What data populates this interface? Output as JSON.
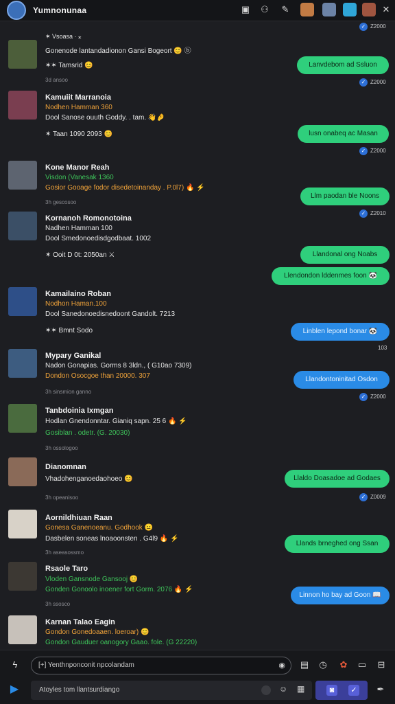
{
  "header": {
    "title": "Yumnonunaa",
    "icons": [
      "screenshot-icon",
      "share-icon",
      "edit-icon",
      "people-icon"
    ]
  },
  "messages": [
    {
      "id": "m0",
      "react": "✶ Vsoasa · ⁎",
      "line1": "Gonenode lantandadionon Gansi Bogeort 😊 ⓑ",
      "react2": "✶✶ Tamsrid 😊",
      "time": "3d ansoo"
    },
    {
      "id": "m1",
      "name": "Kamuiit Marranoia",
      "line1": "Nodhen Hamman 360",
      "line2": "Dool Sanose ouuth Goddy. . tam. 👋🤌",
      "react": "✶ Taan  1090 2093 😊"
    },
    {
      "id": "m2",
      "name": "Kone Manor Reah",
      "line1": "Visdon (Vanesak 1360",
      "line2": "Gosior Gooage fodor disedetoinanday . P.0l7) 🔥 ⚡",
      "time": "3h gescosoo"
    },
    {
      "id": "m3",
      "name": "Kornanoh Romonotoina",
      "line1": "Nadhen Hamman 100",
      "line2": "Dool Smedonoedisdgodbaat. 1002",
      "react": "✶ Ooit  D 0t: 2050an ⚔"
    },
    {
      "id": "m4",
      "name": "Kamailaino Roban",
      "line1": "Nodhon Haman.100",
      "line2": "Dool Sanedonoedisnedoont Gandolt. 7213",
      "react": "✶✶ Bmnt Sodo"
    },
    {
      "id": "m5",
      "name": "Mypary Ganikal",
      "line1": "Nadon Gonapias. Gorms 8 3ldn., ( G10ao 7309)",
      "line2": "Dondon Osocgoe than 20000. 307",
      "time": "3h sinsmion ganno"
    },
    {
      "id": "m6",
      "name": "Tanbdoinia Ixmgan",
      "line1": "Hodlan Gnendonntar. Gianiq sapn. 25 6 🔥 ⚡",
      "line2": "Gosiblan . odetr.  (G. 20030)",
      "time": "3h ossologoo"
    },
    {
      "id": "m7",
      "name": "Dianomnan",
      "line1": "Vhadohenganoedaohoeo 😊",
      "time": "3h opeanisoo"
    },
    {
      "id": "m8",
      "name": "Aornildhiuan Raan",
      "line1": "Gonesa Ganenoeanu.  Godhook 😐",
      "line2": "Dasbelen soneas lnoaoonsten . G4l9 🔥 ⚡",
      "time": "3h aseasossmo"
    },
    {
      "id": "m9",
      "name": "Rsaole Taro",
      "line1": "Vloden Gansnode Gansooj 😊",
      "line2": "Gonden Gonoolo inoener fort Gorm. 2076 🔥 ⚡",
      "time": "3h ssosco"
    },
    {
      "id": "m10",
      "name": "Karnan Talao Eagin",
      "line1": "Gondon Gonedoaaen. loeroar) 😊",
      "line2": "Gondon Gauduer oanogory Gaao. fole. (G 22220)"
    }
  ],
  "outgoing": [
    {
      "text": "Lanvdebom ad Ssluon",
      "time": "Z2000",
      "color": "green"
    },
    {
      "text": "lusn onabeq ac Masan",
      "time": "Z2000",
      "color": "green"
    },
    {
      "text": "Llm paodan ble Noons",
      "time": "Z2010",
      "color": "green"
    },
    {
      "text": "Llandonal ong Noabs",
      "color": "green"
    },
    {
      "text": "Llendondon lddenmes foon 🐼",
      "color": "green"
    },
    {
      "text": "Linblen lepond bonar 🐼",
      "time": "103",
      "color": "blue"
    },
    {
      "text": "Llandontoninitad Osdon",
      "time": "Z2000",
      "color": "blue"
    },
    {
      "text": "Llaldo Doasadoe ad Godaes",
      "time": "Z0009",
      "color": "green"
    },
    {
      "text": "Llands brneghed ong Ssan",
      "color": "green"
    },
    {
      "text": "Linnon ho bay ad Goon 📖",
      "color": "blue"
    }
  ],
  "top_stamp": "Z2000",
  "composer": {
    "search_placeholder": "[+] Yenthnponconit npcolandam",
    "message_placeholder": "Atoyles tom llantsurdiango"
  },
  "colors": {
    "accent_green": "#2fcf7c",
    "accent_blue": "#2a8be6",
    "bg": "#1d1e22"
  }
}
